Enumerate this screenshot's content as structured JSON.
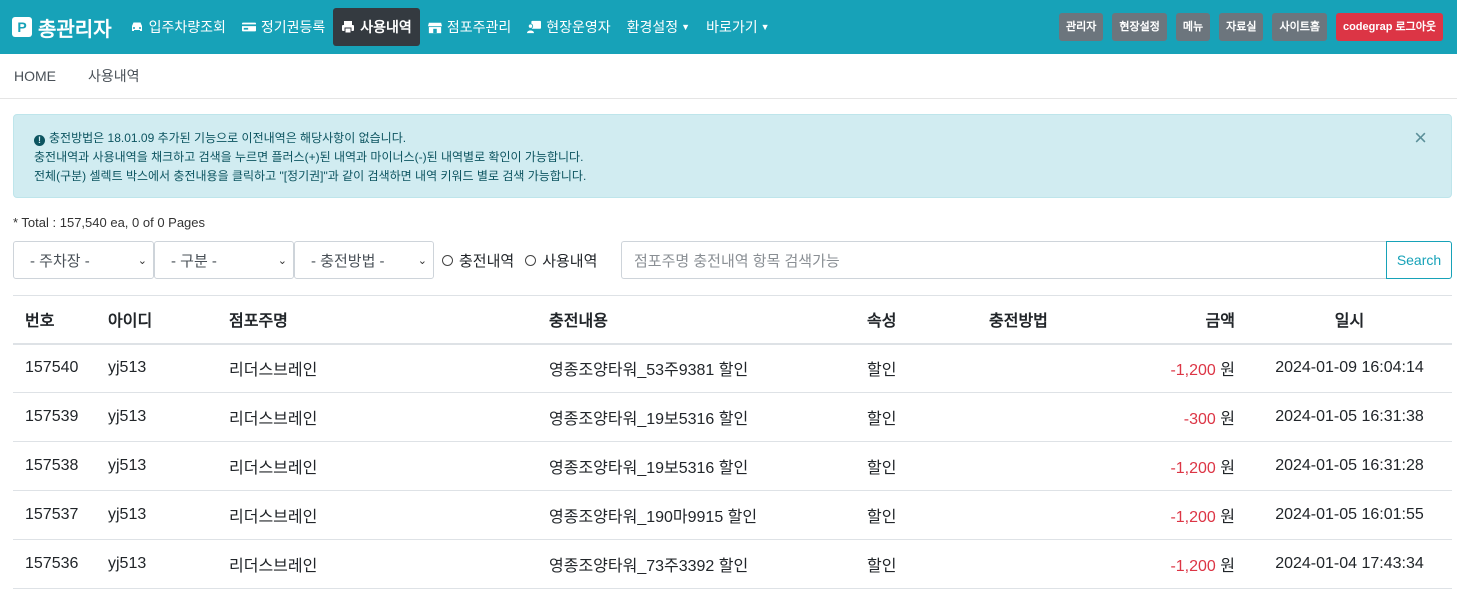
{
  "app": {
    "logo_letter": "P",
    "title": "총관리자"
  },
  "nav": {
    "items": [
      {
        "label": "입주차량조회",
        "icon": "car-icon"
      },
      {
        "label": "정기권등록",
        "icon": "card-icon"
      },
      {
        "label": "사용내역",
        "icon": "print-icon",
        "active": true
      },
      {
        "label": "점포주관리",
        "icon": "store-icon"
      },
      {
        "label": "현장운영자",
        "icon": "user-board-icon"
      },
      {
        "label": "환경설정",
        "dropdown": true
      },
      {
        "label": "바로가기",
        "dropdown": true
      }
    ],
    "right_buttons": [
      "관리자",
      "현장설정",
      "메뉴",
      "자료실",
      "사이트홈",
      "codegrap 로그아웃"
    ]
  },
  "breadcrumb": {
    "home": "HOME",
    "current": "사용내역"
  },
  "alert": {
    "line1": "충전방법은 18.01.09 추가된 기능으로 이전내역은 해당사항이 없습니다.",
    "line2": "충전내역과 사용내역을 채크하고 검색을 누르면 플러스(+)된 내역과 마이너스(-)된 내역별로 확인이 가능합니다.",
    "line3": "전체(구분) 셀렉트 박스에서 충전내용을 클릭하고 \"[정기권]\"과 같이 검색하면 내역 키워드 별로 검색 가능합니다.",
    "close": "×"
  },
  "total": "* Total : 157,540 ea, 0 of 0 Pages",
  "filters": {
    "parking": "- 주차장 -",
    "category": "- 구분 -",
    "method": "- 충전방법 -",
    "radio_charge": "충전내역",
    "radio_usage": "사용내역",
    "search_placeholder": "점포주명 충전내역 항목 검색가능",
    "search_button": "Search"
  },
  "table": {
    "headers": [
      "번호",
      "아이디",
      "점포주명",
      "충전내용",
      "속성",
      "충전방법",
      "금액",
      "일시"
    ],
    "rows": [
      {
        "no": "157540",
        "id": "yj513",
        "store": "리더스브레인",
        "content": "영종조양타워_53주9381 할인",
        "attr": "할인",
        "method": "",
        "amount": "-1,200",
        "unit": "원",
        "datetime": "2024-01-09 16:04:14"
      },
      {
        "no": "157539",
        "id": "yj513",
        "store": "리더스브레인",
        "content": "영종조양타워_19보5316 할인",
        "attr": "할인",
        "method": "",
        "amount": "-300",
        "unit": "원",
        "datetime": "2024-01-05 16:31:38"
      },
      {
        "no": "157538",
        "id": "yj513",
        "store": "리더스브레인",
        "content": "영종조양타워_19보5316 할인",
        "attr": "할인",
        "method": "",
        "amount": "-1,200",
        "unit": "원",
        "datetime": "2024-01-05 16:31:28"
      },
      {
        "no": "157537",
        "id": "yj513",
        "store": "리더스브레인",
        "content": "영종조양타워_190마9915 할인",
        "attr": "할인",
        "method": "",
        "amount": "-1,200",
        "unit": "원",
        "datetime": "2024-01-05 16:01:55"
      },
      {
        "no": "157536",
        "id": "yj513",
        "store": "리더스브레인",
        "content": "영종조양타워_73주3392 할인",
        "attr": "할인",
        "method": "",
        "amount": "-1,200",
        "unit": "원",
        "datetime": "2024-01-04 17:43:34"
      }
    ]
  },
  "colors": {
    "navbar": "#17a2b8",
    "active_nav": "#343a40",
    "negative": "#dc3545",
    "logout": "#dc3545"
  }
}
